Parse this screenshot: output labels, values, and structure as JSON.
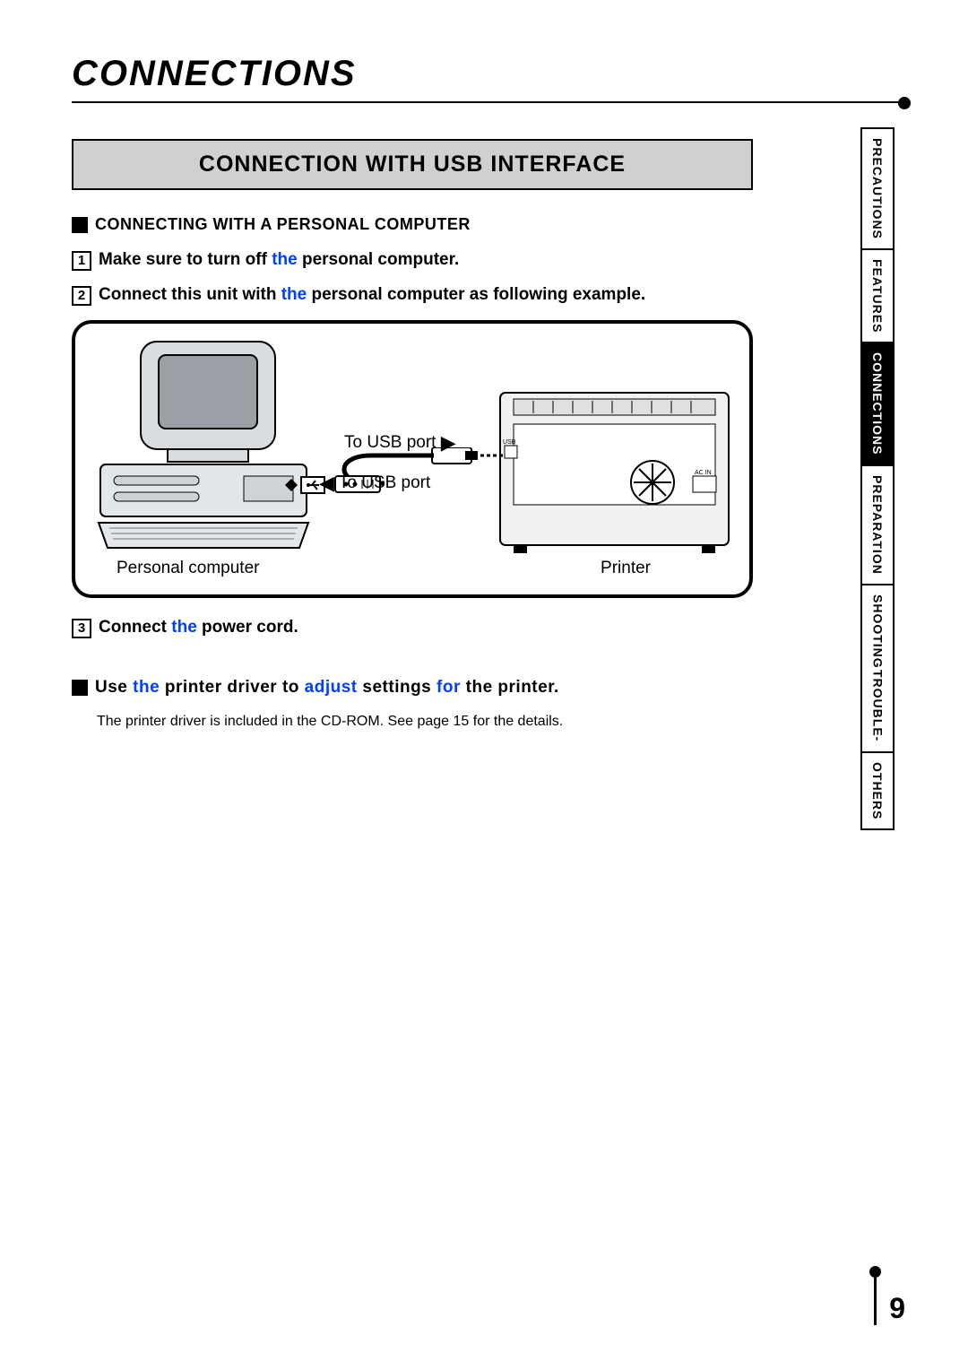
{
  "page": {
    "title": "CONNECTIONS",
    "number": "9"
  },
  "section": {
    "heading": "CONNECTION WITH USB INTERFACE",
    "subheading": "CONNECTING WITH A PERSONAL COMPUTER"
  },
  "steps": {
    "s1_pre": "Make sure to turn off ",
    "s1_blue": "the",
    "s1_post": " personal computer.",
    "s2_pre": "Connect this unit with ",
    "s2_blue": "the",
    "s2_post": " personal computer as following example.",
    "s3_pre": "Connect ",
    "s3_blue": "the",
    "s3_post": " power cord."
  },
  "diagram": {
    "usb_right": "To USB port",
    "usb_left": "To USB port",
    "pc_label": "Personal computer",
    "printer_label": "Printer"
  },
  "driver": {
    "pre1": "Use ",
    "blue1": "the",
    "mid1": " printer driver to ",
    "blue2": "adjust",
    "mid2": " settings ",
    "blue3": "for",
    "post": " the printer.",
    "note": "The printer driver is included in the CD-ROM. See page 15 for the details."
  },
  "tabs": {
    "t1": "PRECAUTIONS",
    "t2": "FEATURES",
    "t3": "CONNECTIONS",
    "t4": "PREPARATION",
    "t5a": "TROUBLE-",
    "t5b": "SHOOTING",
    "t6": "OTHERS"
  }
}
